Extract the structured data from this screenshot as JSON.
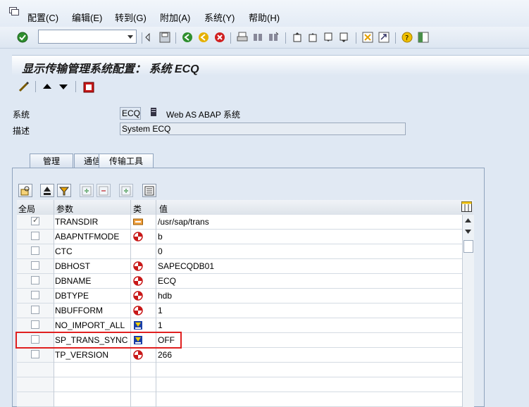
{
  "menu": {
    "items": [
      "配置(C)",
      "编辑(E)",
      "转到(G)",
      "附加(A)",
      "系统(Y)",
      "帮助(H)"
    ]
  },
  "toolbar": {
    "command_field_value": ""
  },
  "title": "显示传输管理系统配置： 系统 ECQ",
  "form": {
    "system_label": "系统",
    "system_value": "ECQ",
    "system_desc": "Web AS ABAP 系统",
    "desc_label": "描述",
    "desc_value": "System ECQ"
  },
  "tabs": [
    "管理",
    "通信",
    "传输工具"
  ],
  "grid": {
    "headers": [
      "全局",
      "参数",
      "类",
      "值"
    ],
    "rows": [
      {
        "global": true,
        "param": "TRANSDIR",
        "type": "folder",
        "value": "/usr/sap/trans"
      },
      {
        "global": false,
        "param": "ABAPNTFMODE",
        "type": "red",
        "value": "b"
      },
      {
        "global": false,
        "param": "CTC",
        "type": "",
        "value": "0"
      },
      {
        "global": false,
        "param": "DBHOST",
        "type": "red",
        "value": "SAPECQDB01"
      },
      {
        "global": false,
        "param": "DBNAME",
        "type": "red",
        "value": "ECQ"
      },
      {
        "global": false,
        "param": "DBTYPE",
        "type": "red",
        "value": "hdb"
      },
      {
        "global": false,
        "param": "NBUFFORM",
        "type": "red",
        "value": "1"
      },
      {
        "global": false,
        "param": "NO_IMPORT_ALL",
        "type": "blue",
        "value": "1"
      },
      {
        "global": false,
        "param": "SP_TRANS_SYNC",
        "type": "blue",
        "value": "OFF"
      },
      {
        "global": false,
        "param": "TP_VERSION",
        "type": "red",
        "value": "266"
      }
    ]
  },
  "colors": {
    "highlight": "#e02020",
    "title_bg": "#dfe8f3"
  }
}
